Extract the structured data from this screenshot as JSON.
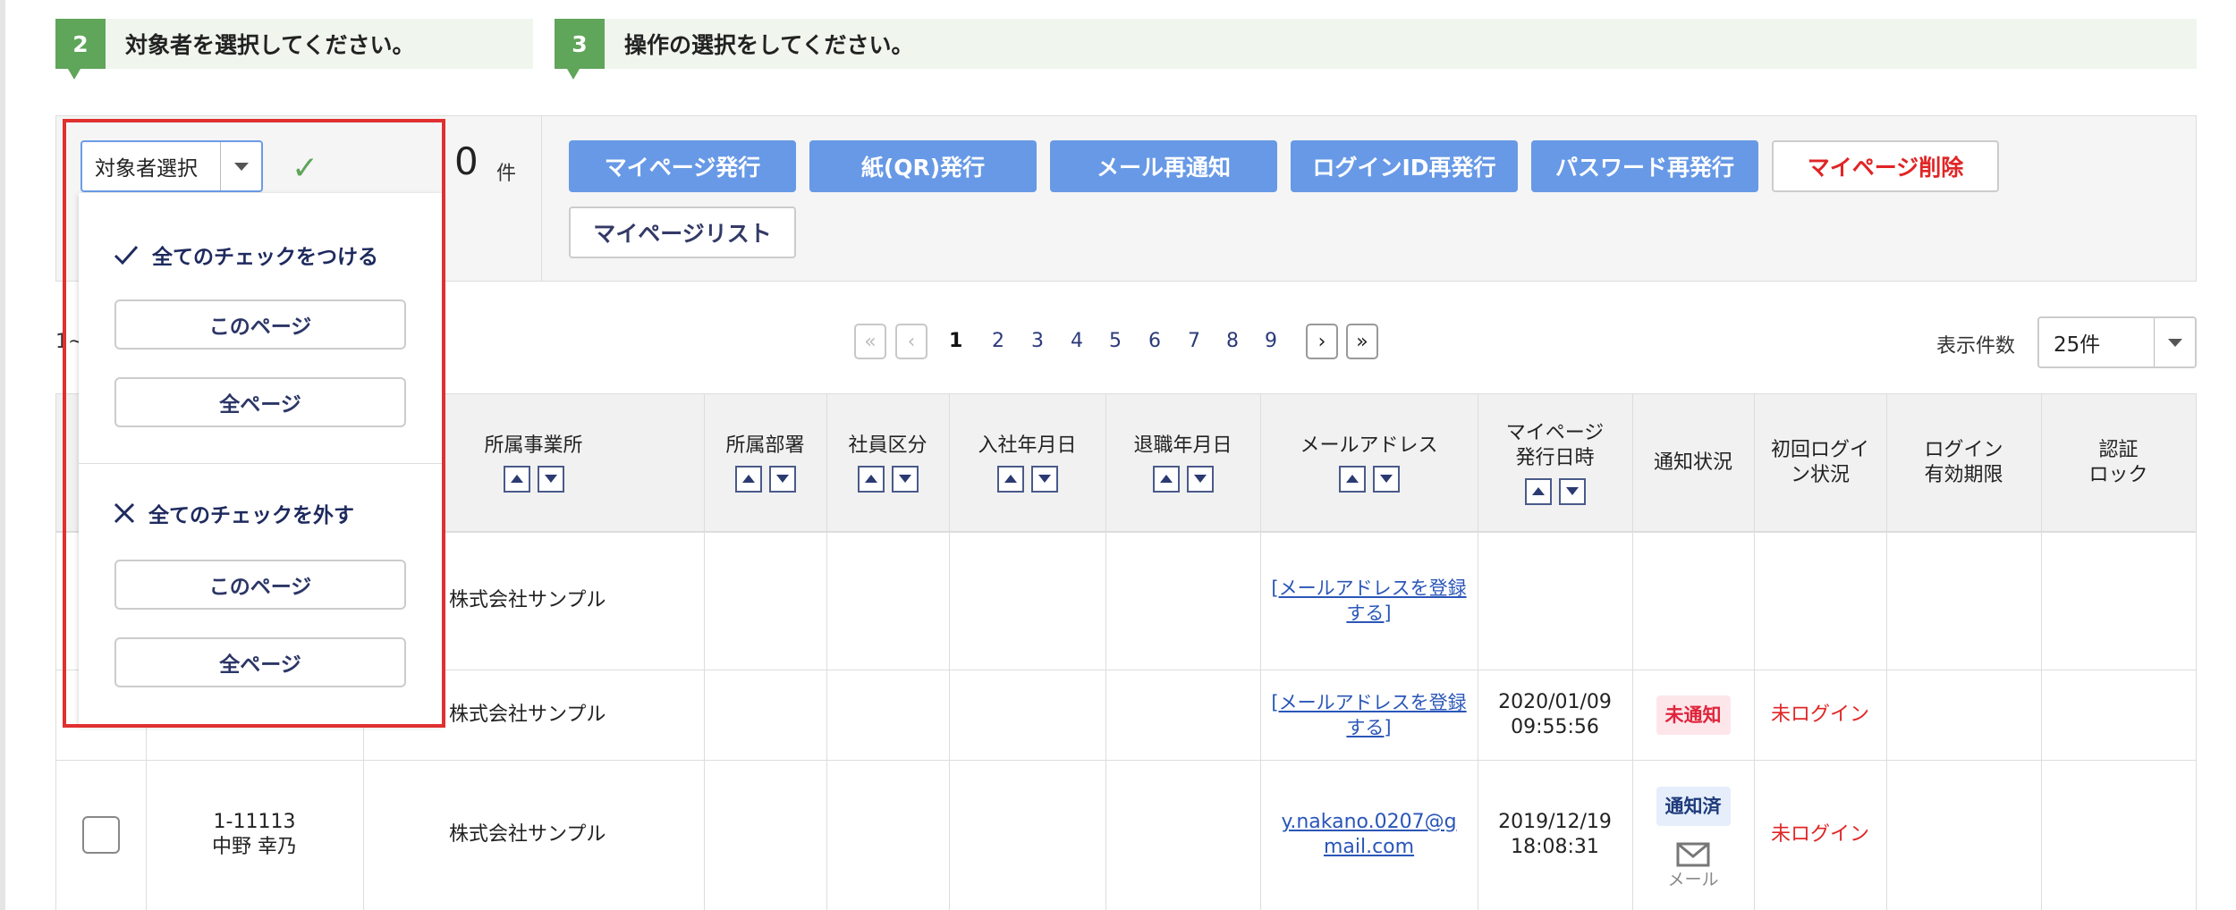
{
  "steps": [
    {
      "num": "2",
      "text": "対象者を選択してください。"
    },
    {
      "num": "3",
      "text": "操作の選択をしてください。"
    }
  ],
  "selector": {
    "label": "対象者選択"
  },
  "count": {
    "value": "0",
    "unit": "件"
  },
  "actions": {
    "mypage_issue": "マイページ発行",
    "paper_issue": "紙(QR)発行",
    "mail_renotify": "メール再通知",
    "login_id_reissue": "ログインID再発行",
    "password_reissue": "パスワード再発行",
    "mypage_delete": "マイページ削除",
    "mypage_list": "マイページリスト"
  },
  "pagination": {
    "range_text": "1~",
    "pages": [
      "1",
      "2",
      "3",
      "4",
      "5",
      "6",
      "7",
      "8",
      "9"
    ],
    "first": "«",
    "prev": "‹",
    "next": "›",
    "last": "»"
  },
  "per_page": {
    "label": "表示件数",
    "value": "25件"
  },
  "table": {
    "headers": {
      "office": "所属事業所",
      "dept": "所属部署",
      "emp_type": "社員区分",
      "join_date": "入社年月日",
      "leave_date": "退職年月日",
      "email": "メールアドレス",
      "mypage_date_1": "マイページ",
      "mypage_date_2": "発行日時",
      "notify_status": "通知状況",
      "first_login_1": "初回ログイ",
      "first_login_2": "ン状況",
      "login_expiry_1": "ログイン",
      "login_expiry_2": "有効期限",
      "auth_lock_1": "認証",
      "auth_lock_2": "ロック"
    },
    "rows": [
      {
        "office": "株式会社サンプル",
        "email_1": "[メールアドレスを登録",
        "email_2": "する]"
      },
      {
        "office": "株式会社サンプル",
        "email_1": "[メールアドレスを登録",
        "email_2": "する]",
        "date_1": "2020/01/09",
        "date_2": "09:55:56",
        "status": "未通知",
        "login": "未ログイン"
      },
      {
        "id": "1-11113",
        "name": "中野 幸乃",
        "office": "株式会社サンプル",
        "email_1": "y.nakano.0207@g",
        "email_2": "mail.com",
        "date_1": "2019/12/19",
        "date_2": "18:08:31",
        "status": "通知済",
        "mail_label": "メール",
        "login": "未ログイン"
      }
    ]
  },
  "dropdown": {
    "check_all_title": "全てのチェックをつける",
    "uncheck_all_title": "全てのチェックを外す",
    "this_page": "このページ",
    "all_pages": "全ページ"
  },
  "colors": {
    "step_green": "#5fa55a",
    "action_blue": "#6799e6",
    "danger_red": "#e02525",
    "highlight_red": "#e03030"
  }
}
